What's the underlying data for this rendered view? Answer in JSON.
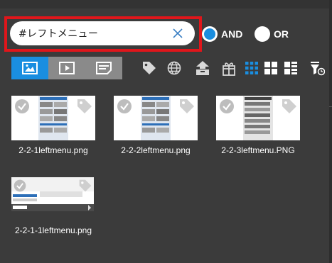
{
  "search": {
    "value": "#レフトメニュー"
  },
  "match_mode": {
    "and_label": "AND",
    "or_label": "OR",
    "selected": "AND"
  },
  "view_tabs": [
    {
      "icon": "image-icon",
      "active": true
    },
    {
      "icon": "video-icon",
      "active": false
    },
    {
      "icon": "document-icon",
      "active": false
    }
  ],
  "toolbar_icons": [
    "tag-icon",
    "globe-icon",
    "upload-box-icon",
    "gift-box-icon",
    "small-grid-icon",
    "large-grid-icon",
    "list-view-icon",
    "sort-filter-icon"
  ],
  "files": [
    {
      "name": "2-2-1leftmenu.png"
    },
    {
      "name": "2-2-2leftmenu.png"
    },
    {
      "name": "2-2-3leftmenu.PNG"
    },
    {
      "name": "2-2-1-1leftmenu.png"
    }
  ],
  "colors": {
    "accent": "#1a8ee0",
    "highlight_outline": "#e0161b",
    "background": "#3b3b3b"
  }
}
